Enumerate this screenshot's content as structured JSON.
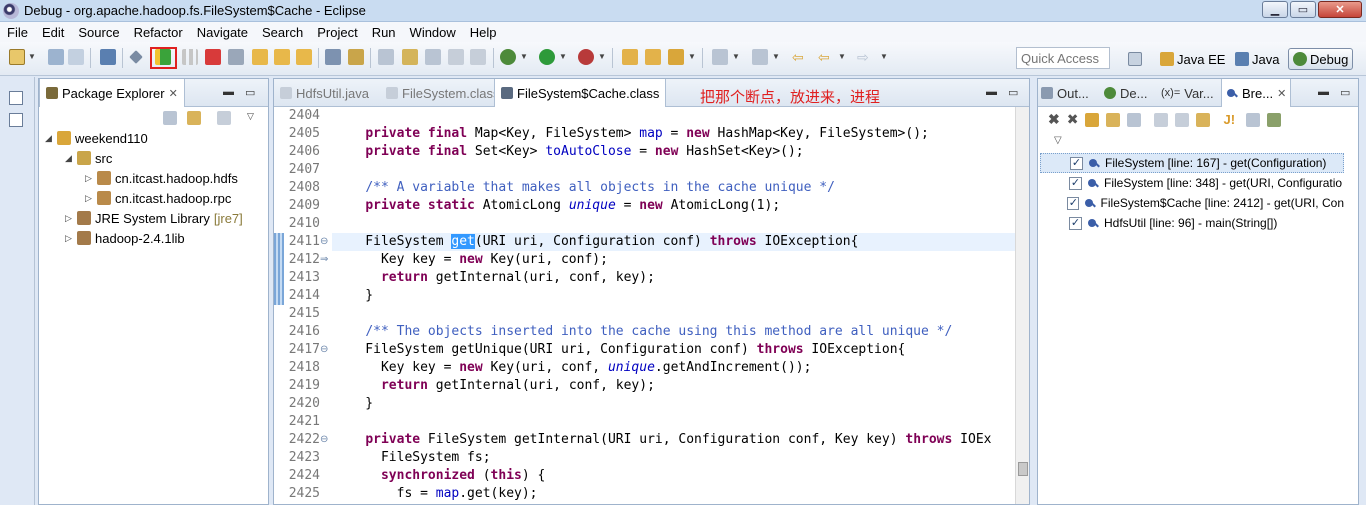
{
  "window": {
    "title": "Debug - org.apache.hadoop.fs.FileSystem$Cache - Eclipse"
  },
  "menu": [
    "File",
    "Edit",
    "Source",
    "Refactor",
    "Navigate",
    "Search",
    "Project",
    "Run",
    "Window",
    "Help"
  ],
  "quick_access": {
    "placeholder": "Quick Access"
  },
  "perspectives": [
    {
      "label": "Java EE",
      "active": false
    },
    {
      "label": "Java",
      "active": false
    },
    {
      "label": "Debug",
      "active": true
    }
  ],
  "package_explorer": {
    "tab_label": "Package Explorer",
    "tree": [
      {
        "label": "weekend110",
        "suffix": ""
      },
      {
        "label": "src",
        "suffix": ""
      },
      {
        "label": "cn.itcast.hadoop.hdfs",
        "suffix": ""
      },
      {
        "label": "cn.itcast.hadoop.rpc",
        "suffix": ""
      },
      {
        "label": "JRE System Library",
        "suffix": "[jre7]"
      },
      {
        "label": "hadoop-2.4.1lib",
        "suffix": ""
      }
    ]
  },
  "editor": {
    "tabs": [
      {
        "label": "HdfsUtil.java",
        "active": false
      },
      {
        "label": "FileSystem.class",
        "active": false
      },
      {
        "label": "FileSystem$Cache.class",
        "active": true
      }
    ],
    "annotation": "把那个断点，放进来，进程",
    "line_numbers": [
      "2404",
      "2405",
      "2406",
      "2407",
      "2408",
      "2409",
      "2410",
      "2411",
      "2412",
      "2413",
      "2414",
      "2415",
      "2416",
      "2417",
      "2418",
      "2419",
      "2420",
      "2421",
      "2422",
      "2423",
      "2424",
      "2425"
    ]
  },
  "right_panel": {
    "tabs": [
      {
        "label": "Out..."
      },
      {
        "label": "De..."
      },
      {
        "label": "Var..."
      },
      {
        "label": "Bre..."
      }
    ],
    "breakpoints": [
      {
        "label": "FileSystem [line: 167] - get(Configuration)",
        "checked": true
      },
      {
        "label": "FileSystem [line: 348] - get(URI, Configuratio",
        "checked": true
      },
      {
        "label": "FileSystem$Cache [line: 2412] - get(URI, Con",
        "checked": true
      },
      {
        "label": "HdfsUtil [line: 96] - main(String[])",
        "checked": true
      }
    ]
  }
}
